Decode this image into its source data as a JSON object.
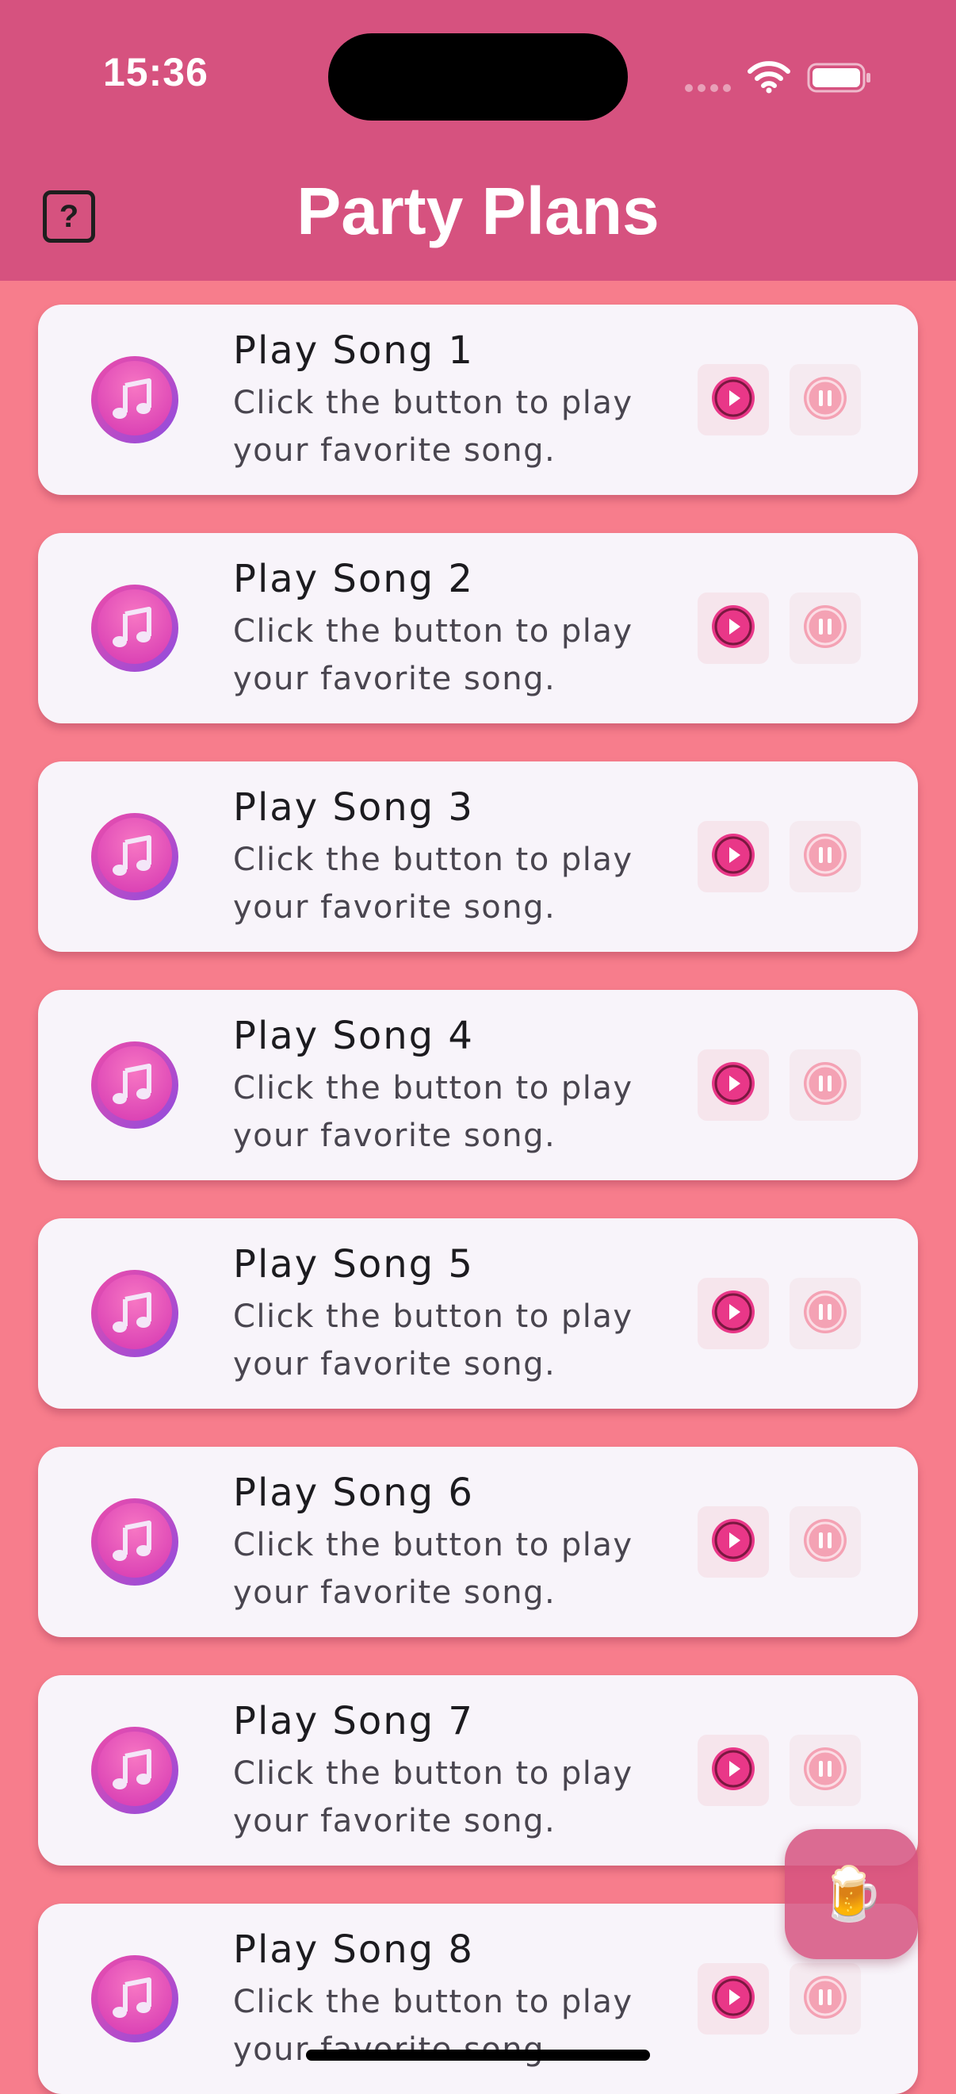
{
  "status_bar": {
    "time": "15:36",
    "wifi_icon": "wifi-icon",
    "battery_icon": "battery-icon"
  },
  "header": {
    "title": "Party Plans",
    "help_label": "?",
    "background": "#D6527F"
  },
  "songs": [
    {
      "title": "Play Song 1",
      "description": "Click the button to play your favorite song."
    },
    {
      "title": "Play Song 2",
      "description": "Click the button to play your favorite song."
    },
    {
      "title": "Play Song 3",
      "description": "Click the button to play your favorite song."
    },
    {
      "title": "Play Song 4",
      "description": "Click the button to play your favorite song."
    },
    {
      "title": "Play Song 5",
      "description": "Click the button to play your favorite song."
    },
    {
      "title": "Play Song 6",
      "description": "Click the button to play your favorite song."
    },
    {
      "title": "Play Song 7",
      "description": "Click the button to play your favorite song."
    },
    {
      "title": "Play Song 8",
      "description": "Click the button to play your favorite song."
    }
  ],
  "fab": {
    "emoji": "🍺",
    "icon": "beer-mug-icon"
  },
  "colors": {
    "page_background": "#F77D8C",
    "card_background": "#F8F4FA",
    "accent": "#E8388B"
  }
}
